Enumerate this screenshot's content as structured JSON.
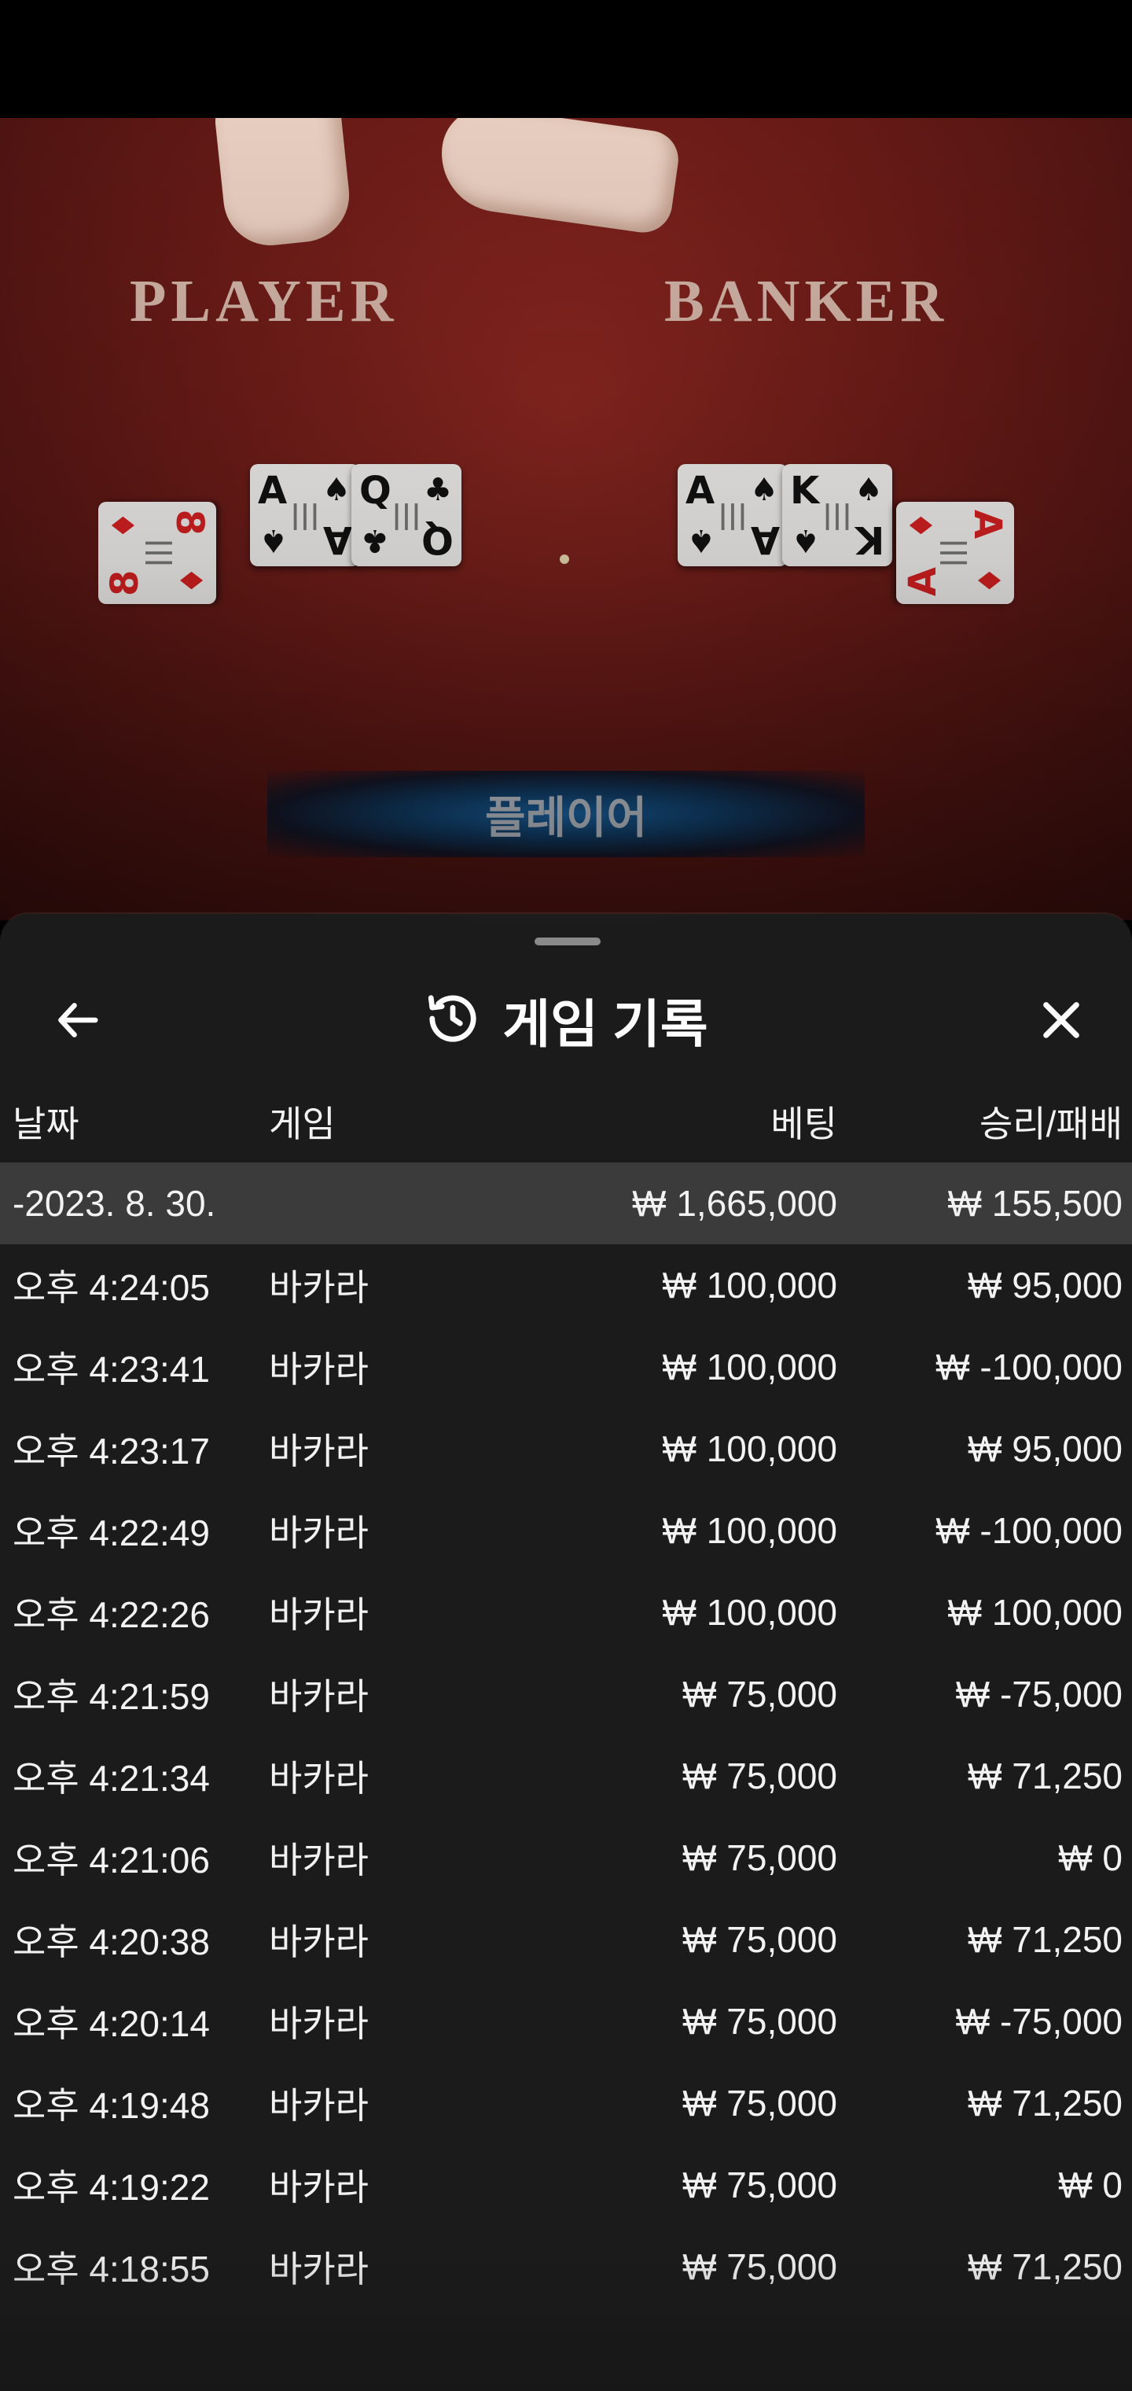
{
  "video": {
    "player_label": "PLAYER",
    "banker_label": "BANKER",
    "winner_text": "플레이어",
    "player_cards": [
      {
        "rank": "8",
        "suit": "♦",
        "red": true
      },
      {
        "rank": "A",
        "suit": "♠",
        "red": false
      },
      {
        "rank": "Q",
        "suit": "♣",
        "red": false
      }
    ],
    "banker_cards": [
      {
        "rank": "A",
        "suit": "♠",
        "red": false
      },
      {
        "rank": "K",
        "suit": "♠",
        "red": false
      },
      {
        "rank": "A",
        "suit": "♦",
        "red": true
      }
    ]
  },
  "sheet": {
    "title": "게임 기록",
    "icons": {
      "back": "arrow-left-icon",
      "history": "history-icon",
      "close": "close-icon"
    },
    "columns": {
      "date": "날짜",
      "game": "게임",
      "bet": "베팅",
      "result": "승리/패배"
    },
    "summary": {
      "date": "-2023. 8. 30.",
      "bet": "₩ 1,665,000",
      "result": "₩ 155,500"
    },
    "rows": [
      {
        "time": "오후 4:24:05",
        "game": "바카라",
        "bet": "₩ 100,000",
        "result": "₩ 95,000"
      },
      {
        "time": "오후 4:23:41",
        "game": "바카라",
        "bet": "₩ 100,000",
        "result": "₩ -100,000"
      },
      {
        "time": "오후 4:23:17",
        "game": "바카라",
        "bet": "₩ 100,000",
        "result": "₩ 95,000"
      },
      {
        "time": "오후 4:22:49",
        "game": "바카라",
        "bet": "₩ 100,000",
        "result": "₩ -100,000"
      },
      {
        "time": "오후 4:22:26",
        "game": "바카라",
        "bet": "₩ 100,000",
        "result": "₩ 100,000"
      },
      {
        "time": "오후 4:21:59",
        "game": "바카라",
        "bet": "₩ 75,000",
        "result": "₩ -75,000"
      },
      {
        "time": "오후 4:21:34",
        "game": "바카라",
        "bet": "₩ 75,000",
        "result": "₩ 71,250"
      },
      {
        "time": "오후 4:21:06",
        "game": "바카라",
        "bet": "₩ 75,000",
        "result": "₩ 0"
      },
      {
        "time": "오후 4:20:38",
        "game": "바카라",
        "bet": "₩ 75,000",
        "result": "₩ 71,250"
      },
      {
        "time": "오후 4:20:14",
        "game": "바카라",
        "bet": "₩ 75,000",
        "result": "₩ -75,000"
      },
      {
        "time": "오후 4:19:48",
        "game": "바카라",
        "bet": "₩ 75,000",
        "result": "₩ 71,250"
      },
      {
        "time": "오후 4:19:22",
        "game": "바카라",
        "bet": "₩ 75,000",
        "result": "₩ 0"
      },
      {
        "time": "오후 4:18:55",
        "game": "바카라",
        "bet": "₩ 75,000",
        "result": "₩ 71,250"
      }
    ]
  }
}
